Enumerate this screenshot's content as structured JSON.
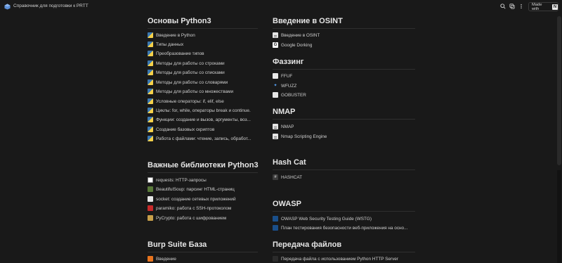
{
  "header": {
    "title": "Справочник для подготовки к PRTT",
    "made_with_label": "Made with",
    "made_with_logo": "N",
    "icons": [
      "search-icon",
      "duplicate-icon",
      "more-icon"
    ]
  },
  "sections": {
    "python": {
      "heading": "Основы Python3",
      "items": [
        {
          "label": "Введение в Python",
          "icon": "python"
        },
        {
          "label": "Типы данных",
          "icon": "python"
        },
        {
          "label": "Преобразование типов",
          "icon": "python"
        },
        {
          "label": "Методы для работы со строками",
          "icon": "python"
        },
        {
          "label": "Методы для работы со списками",
          "icon": "python"
        },
        {
          "label": "Методы для работы со словарями",
          "icon": "python"
        },
        {
          "label": "Методы для работы со множествами",
          "icon": "python"
        },
        {
          "label": "Условные операторы: if, elif, else",
          "icon": "python"
        },
        {
          "label": "Циклы: for, while, операторы break и continue.",
          "icon": "python"
        },
        {
          "label": "Функции: создание и вызов, аргументы, воз...",
          "icon": "python"
        },
        {
          "label": "Создание базовых скриптов",
          "icon": "python"
        },
        {
          "label": "Работа с файлами: чтение, запись, обработ...",
          "icon": "python"
        }
      ]
    },
    "libs": {
      "heading": "Важные библиотеки Python3",
      "items": [
        {
          "label": "requests: HTTP-запросы",
          "icon": "requests"
        },
        {
          "label": "BeautifulSoup: парсинг HTML-страниц",
          "icon": "beautifulsoup"
        },
        {
          "label": "socket: создание сетевых приложений",
          "icon": "socket"
        },
        {
          "label": "paramiko: работа с SSH-протоколом",
          "icon": "ssh"
        },
        {
          "label": "PyCrypto: работа с шифрованием",
          "icon": "key"
        }
      ]
    },
    "burp": {
      "heading": "Burp Suite База",
      "items": [
        {
          "label": "Введение",
          "icon": "burp"
        }
      ]
    },
    "osint": {
      "heading": "Введение в OSINT",
      "items": [
        {
          "label": "Введение в OSINT",
          "icon": "doc"
        },
        {
          "label": "Google Dorking",
          "icon": "google"
        }
      ]
    },
    "fuzzing": {
      "heading": "Фаззинг",
      "items": [
        {
          "label": "FFUF",
          "icon": "ffuf"
        },
        {
          "label": "WFUZZ",
          "icon": "wfuzz"
        },
        {
          "label": "GOBUSTER",
          "icon": "gobuster"
        }
      ]
    },
    "nmap": {
      "heading": "NMAP",
      "items": [
        {
          "label": "NMAP",
          "icon": "doc"
        },
        {
          "label": "Nmap Scripting Engine",
          "icon": "doc"
        }
      ]
    },
    "hashcat": {
      "heading": "Hash Cat",
      "items": [
        {
          "label": "HASHCAT",
          "icon": "hashcat"
        }
      ]
    },
    "owasp": {
      "heading": "OWASP",
      "items": [
        {
          "label": "OWASP Web Security Testing Guide (WSTG)",
          "icon": "owasp"
        },
        {
          "label": "План тестирования безопасности веб-приложения на осно...",
          "icon": "owasp"
        }
      ]
    },
    "transfer": {
      "heading": "Передача файлов",
      "items": [
        {
          "label": "Передача файла с использованием Python HTTP Server",
          "icon": "terminal"
        }
      ]
    }
  }
}
